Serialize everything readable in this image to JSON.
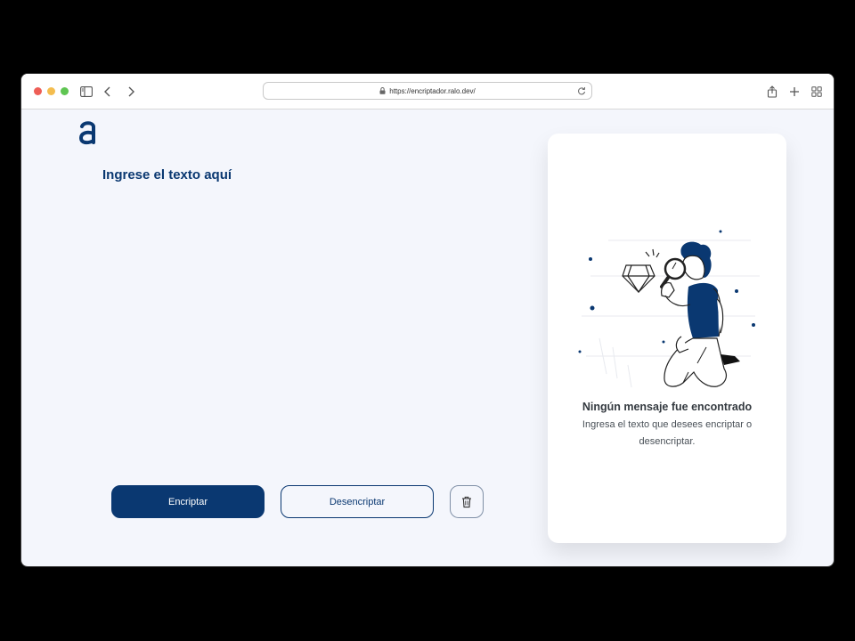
{
  "browser": {
    "url": "https://encriptador.ralo.dev/"
  },
  "app": {
    "logo_letter": "a",
    "prompt_label": "Ingrese el texto aquí",
    "input_value": "",
    "encrypt_label": "Encriptar",
    "decrypt_label": "Desencriptar"
  },
  "result_panel": {
    "title": "Ningún mensaje fue encontrado",
    "description": "Ingresa el texto que desees encriptar o desencriptar."
  },
  "colors": {
    "brand": "#0a3871",
    "background": "#f4f6fc"
  },
  "icons": {
    "sidebar": "sidebar-icon",
    "back": "chevron-left-icon",
    "forward": "chevron-right-icon",
    "share": "share-icon",
    "new_tab": "plus-icon",
    "tabs": "tab-overview-icon",
    "clear": "trash-icon"
  }
}
